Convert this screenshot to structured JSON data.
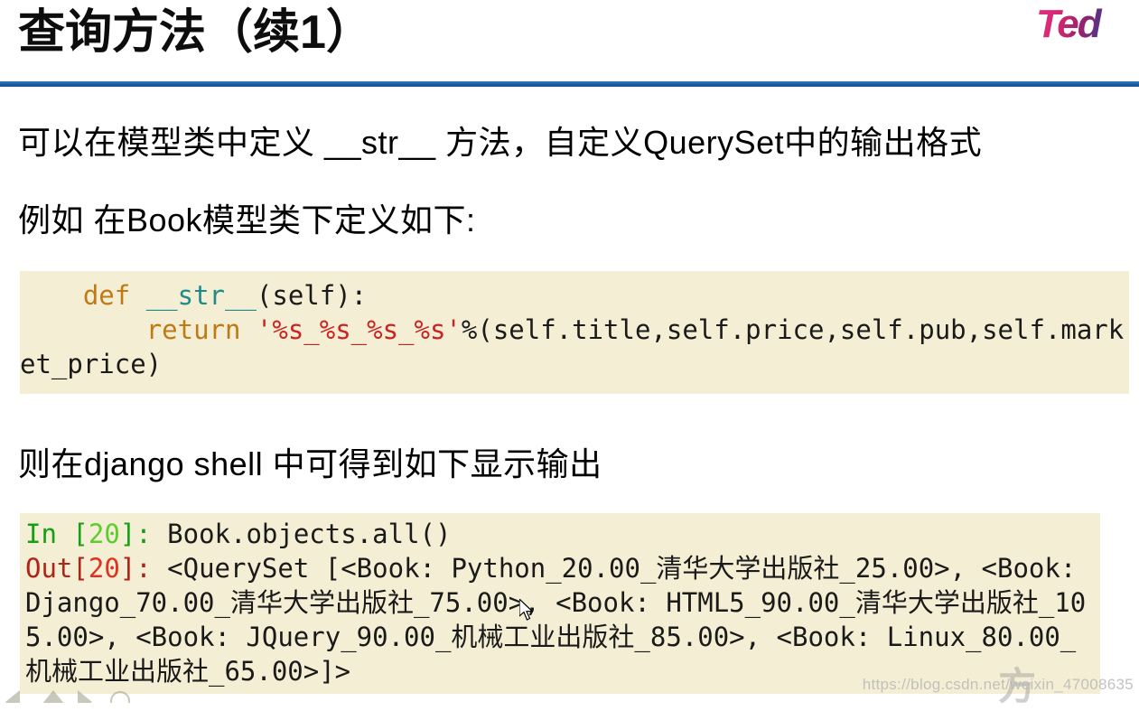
{
  "slide": {
    "title": "查询方法（续1）",
    "brand": {
      "logo_text": "Ted",
      "gradient_from": "#e8308a",
      "gradient_to": "#17306f"
    },
    "accent_rule_color": "#1a5ba6",
    "code_background": "#f4efd4"
  },
  "body": {
    "paragraph_1": "可以在模型类中定义 __str__ 方法，自定义QuerySet中的输出格式",
    "paragraph_2": "例如 在Book模型类下定义如下:",
    "paragraph_3": "则在django shell 中可得到如下显示输出"
  },
  "code_def": {
    "line1_indent": "    ",
    "kw_def": "def",
    "fn_name": "__str__",
    "line1_tail": "(self):",
    "line2_indent": "        ",
    "kw_return": "return",
    "format_string": "'%s_%s_%s_%s'",
    "line2_tail": "%(self.title,self.price,self.pub,self.market_price)"
  },
  "code_shell": {
    "in_label": "In ",
    "in_bracket_open": "[",
    "in_number": "20",
    "in_bracket_close": "]",
    "in_colon": ": ",
    "in_command": "Book.objects.all()",
    "out_label": "Out",
    "out_bracket_open": "[",
    "out_number": "20",
    "out_bracket_close": "]",
    "out_colon": ": ",
    "out_value": "<QuerySet [<Book: Python_20.00_清华大学出版社_25.00>, <Book: Django_70.00_清华大学出版社_75.00>, <Book: HTML5_90.00_清华大学出版社_105.00>, <Book: JQuery_90.00_机械工业出版社_85.00>, <Book: Linux_80.00_机械工业出版社_65.00>]>"
  },
  "watermark": {
    "url": "https://blog.csdn.net/weixin_47008635",
    "cjk": "方"
  },
  "nav": {
    "prev": "previous-slide",
    "up": "slide-menu-up",
    "next": "next-slide",
    "menu": "slide-options"
  }
}
